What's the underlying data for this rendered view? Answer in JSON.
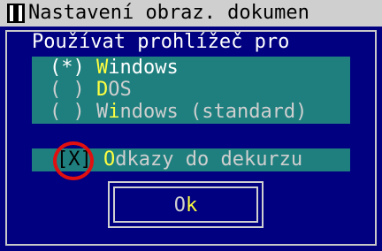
{
  "window": {
    "title": "Nastavení obraz. dokumen",
    "prompt": "Používat prohlížeč pro"
  },
  "radio_options": [
    {
      "mark": "(*)",
      "hot": "W",
      "rest": "indows",
      "selected": true
    },
    {
      "mark": "( )",
      "hot": "D",
      "rest": "OS",
      "selected": false
    },
    {
      "mark": "( )",
      "hot": "",
      "rest_pre": "W",
      "hot_mid": "i",
      "rest_post": "ndows (standard)",
      "selected": false
    }
  ],
  "checkbox": {
    "mark": "[X]",
    "hot": "O",
    "rest": "dkazy do dekurzu",
    "checked": true
  },
  "ok_button": {
    "pre": "O",
    "hot": "k"
  },
  "colors": {
    "background": "#000080",
    "panel": "#1f7f7f",
    "hotkey": "#ffff40",
    "title_bar": "#cfcfcf",
    "highlight_circle": "#e01010"
  }
}
